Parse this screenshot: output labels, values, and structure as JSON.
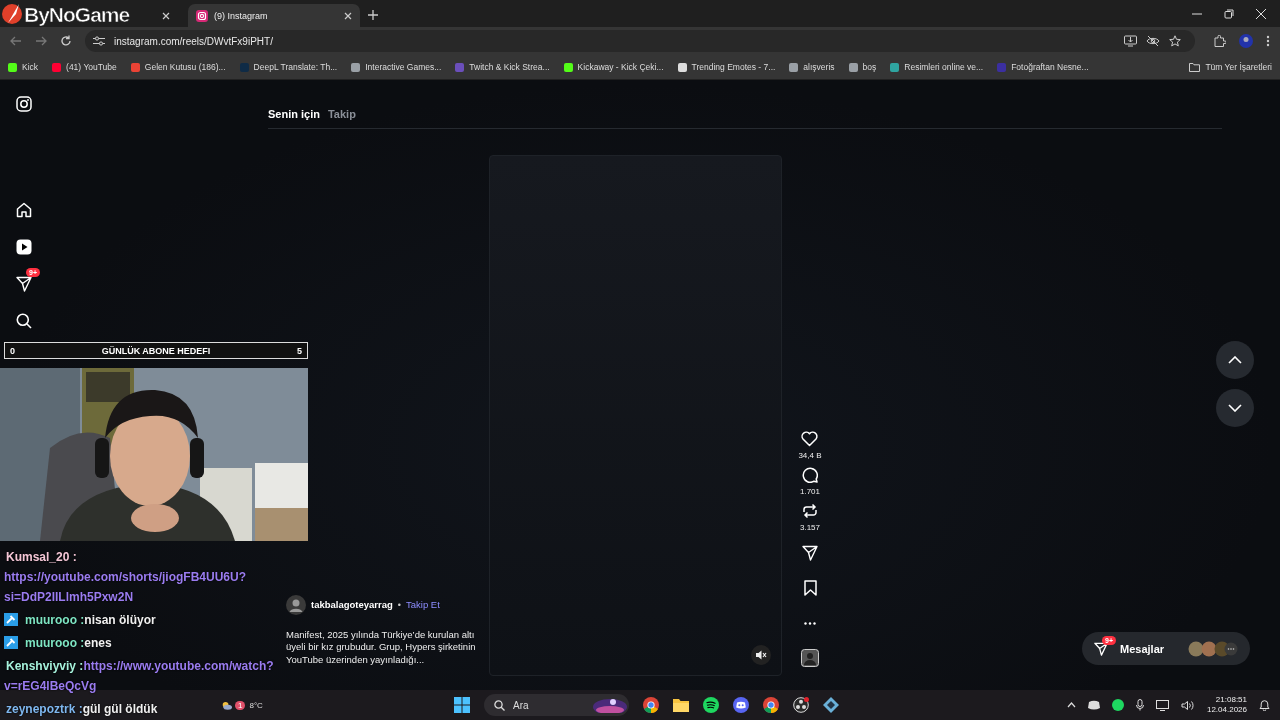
{
  "browser": {
    "tabs": [
      {
        "selected": false
      },
      {
        "label": "(9) Instagram",
        "selected": true
      }
    ],
    "url": "instagram.com/reels/DWvtFx9iPHT/",
    "bookmarks": [
      {
        "label": "Kick",
        "color": "#53fc18"
      },
      {
        "label": "(41) YouTube",
        "color": "#ff0033"
      },
      {
        "label": "Gelen Kutusu (186)...",
        "color": "#ea4335"
      },
      {
        "label": "DeepL Translate: Th...",
        "color": "#0f2b46"
      },
      {
        "label": "Interactive Games...",
        "color": "#9aa0a6"
      },
      {
        "label": "Twitch & Kick Strea...",
        "color": "#6b4fbb"
      },
      {
        "label": "Kickaway - Kick Çeki...",
        "color": "#53fc18"
      },
      {
        "label": "Trending Emotes - 7...",
        "color": "#dddddd"
      },
      {
        "label": "alışveris",
        "color": "#9aa0a6"
      },
      {
        "label": "boş",
        "color": "#9aa0a6"
      },
      {
        "label": "Resimleri online ve...",
        "color": "#2fa4a0"
      },
      {
        "label": "Fotoğraftan Nesne...",
        "color": "#3b2fa0"
      }
    ],
    "all_bookmarks": "Tüm Yer İşaretleri"
  },
  "instagram": {
    "sidebar": [
      {
        "kind": "logo"
      },
      {
        "kind": "home"
      },
      {
        "kind": "reels"
      },
      {
        "kind": "messages",
        "badge": "9+"
      },
      {
        "kind": "search"
      }
    ],
    "feed_tabs": [
      {
        "label": "Senin için",
        "selected": true
      },
      {
        "label": "Takip",
        "selected": false
      }
    ],
    "reel": {
      "author": "takbalagoteyarrag",
      "separator": "•",
      "follow": "Takip Et",
      "caption": "Manifest, 2025 yılında Türkiye’de kurulan altı üyeli bir kız grubudur. Grup, Hypers şirketinin YouTube üzerinden yayınladığı...",
      "muted": true
    },
    "actions": [
      {
        "kind": "like",
        "count": "34,4 B"
      },
      {
        "kind": "comment",
        "count": "1.701"
      },
      {
        "kind": "repost",
        "count": "3.157"
      },
      {
        "kind": "share"
      },
      {
        "kind": "save"
      },
      {
        "kind": "more"
      },
      {
        "kind": "audio"
      }
    ],
    "messages": {
      "label": "Mesajlar",
      "badge": "9+"
    }
  },
  "stream_overlay": {
    "logo": "ByNoGame",
    "goal": {
      "start": "0",
      "title": "GÜNLÜK ABONE HEDEFI",
      "target": "5",
      "level": 0
    },
    "chat": [
      {
        "user": "Kumsal_20 :",
        "color": "#f4c6d6",
        "text": "https://youtube.com/shorts/jiogFB4UU6U?si=DdP2IILlmh5Pxw2N",
        "kind": "link",
        "newline": true
      },
      {
        "user": "muurooo :",
        "color": "#7ee6c4",
        "text": "nisan ölüyor",
        "kind": "text",
        "badge": true,
        "newline": false
      },
      {
        "user": "muurooo :",
        "color": "#7ee6c4",
        "text": "enes",
        "kind": "text",
        "badge": true,
        "newline": false
      },
      {
        "user": "Kenshviyviy :",
        "color": "#a6f2dc",
        "text": "https://www.youtube.com/watch?v=rEG4lBeQcVg",
        "kind": "link",
        "newline": false
      },
      {
        "user": "zeynepoztrk :",
        "color": "#7fb8f0",
        "text": "gül gül öldük",
        "kind": "text",
        "newline": false
      }
    ]
  },
  "taskbar": {
    "weather": {
      "temp": "8°C",
      "badge": "1"
    },
    "search": "Ara",
    "time": "21:08:51",
    "date": "12.04.2026"
  }
}
